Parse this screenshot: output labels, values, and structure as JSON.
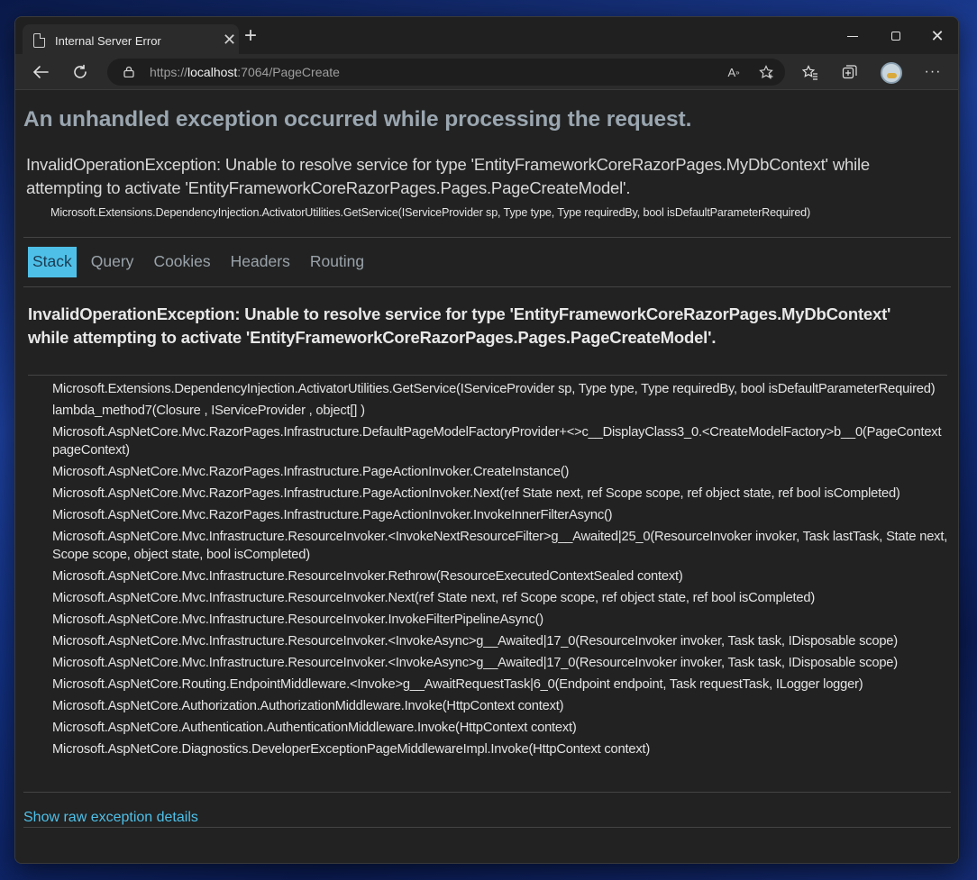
{
  "browser": {
    "tab_title": "Internal Server Error",
    "url_scheme": "https://",
    "url_host": "localhost",
    "url_rest": ":7064/PageCreate"
  },
  "page": {
    "heading": "An unhandled exception occurred while processing the request.",
    "message": "InvalidOperationException: Unable to resolve service for type 'EntityFrameworkCoreRazorPages.MyDbContext' while attempting to activate 'EntityFrameworkCoreRazorPages.Pages.PageCreateModel'.",
    "location": "Microsoft.Extensions.DependencyInjection.ActivatorUtilities.GetService(IServiceProvider sp, Type type, Type requiredBy, bool isDefaultParameterRequired)",
    "tabs": [
      "Stack",
      "Query",
      "Cookies",
      "Headers",
      "Routing"
    ],
    "active_tab": "Stack",
    "exception_heading": "InvalidOperationException: Unable to resolve service for type 'EntityFrameworkCoreRazorPages.MyDbContext' while attempting to activate 'EntityFrameworkCoreRazorPages.Pages.PageCreateModel'.",
    "frames": [
      "Microsoft.Extensions.DependencyInjection.ActivatorUtilities.GetService(IServiceProvider sp, Type type, Type requiredBy, bool isDefaultParameterRequired)",
      "lambda_method7(Closure , IServiceProvider , object[] )",
      "Microsoft.AspNetCore.Mvc.RazorPages.Infrastructure.DefaultPageModelFactoryProvider+<>c__DisplayClass3_0.<CreateModelFactory>b__0(PageContext pageContext)",
      "Microsoft.AspNetCore.Mvc.RazorPages.Infrastructure.PageActionInvoker.CreateInstance()",
      "Microsoft.AspNetCore.Mvc.RazorPages.Infrastructure.PageActionInvoker.Next(ref State next, ref Scope scope, ref object state, ref bool isCompleted)",
      "Microsoft.AspNetCore.Mvc.RazorPages.Infrastructure.PageActionInvoker.InvokeInnerFilterAsync()",
      "Microsoft.AspNetCore.Mvc.Infrastructure.ResourceInvoker.<InvokeNextResourceFilter>g__Awaited|25_0(ResourceInvoker invoker, Task lastTask, State next, Scope scope, object state, bool isCompleted)",
      "Microsoft.AspNetCore.Mvc.Infrastructure.ResourceInvoker.Rethrow(ResourceExecutedContextSealed context)",
      "Microsoft.AspNetCore.Mvc.Infrastructure.ResourceInvoker.Next(ref State next, ref Scope scope, ref object state, ref bool isCompleted)",
      "Microsoft.AspNetCore.Mvc.Infrastructure.ResourceInvoker.InvokeFilterPipelineAsync()",
      "Microsoft.AspNetCore.Mvc.Infrastructure.ResourceInvoker.<InvokeAsync>g__Awaited|17_0(ResourceInvoker invoker, Task task, IDisposable scope)",
      "Microsoft.AspNetCore.Mvc.Infrastructure.ResourceInvoker.<InvokeAsync>g__Awaited|17_0(ResourceInvoker invoker, Task task, IDisposable scope)",
      "Microsoft.AspNetCore.Routing.EndpointMiddleware.<Invoke>g__AwaitRequestTask|6_0(Endpoint endpoint, Task requestTask, ILogger logger)",
      "Microsoft.AspNetCore.Authorization.AuthorizationMiddleware.Invoke(HttpContext context)",
      "Microsoft.AspNetCore.Authentication.AuthenticationMiddleware.Invoke(HttpContext context)",
      "Microsoft.AspNetCore.Diagnostics.DeveloperExceptionPageMiddlewareImpl.Invoke(HttpContext context)"
    ],
    "raw_link": "Show raw exception details"
  },
  "colors": {
    "accent": "#4ec0e8",
    "heading": "#9aa6b0",
    "background": "#222222"
  }
}
